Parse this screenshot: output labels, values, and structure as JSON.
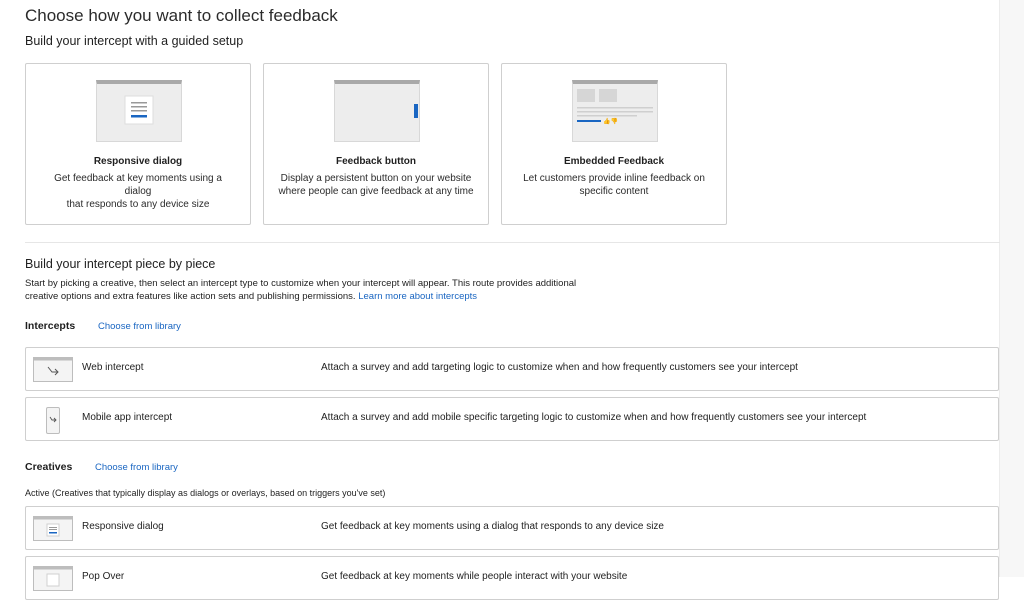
{
  "page": {
    "title": "Choose how you want to collect feedback",
    "guided_heading": "Build your intercept with a guided setup"
  },
  "cards": [
    {
      "title": "Responsive dialog",
      "desc_line1": "Get feedback at key moments using a dialog",
      "desc_line2": "that responds to any device size",
      "icon": "responsive-dialog-thumbnail"
    },
    {
      "title": "Feedback button",
      "desc_line1": "Display a persistent button on your website",
      "desc_line2": "where people can give feedback at any time",
      "icon": "feedback-button-thumbnail"
    },
    {
      "title": "Embedded Feedback",
      "desc_line1": "Let customers provide inline feedback on",
      "desc_line2": "specific content",
      "icon": "embedded-feedback-thumbnail"
    }
  ],
  "piece": {
    "heading": "Build your intercept piece by piece",
    "desc_line1": "Start by picking a creative, then select an intercept type to customize when your intercept will appear. This route provides additional",
    "desc_line2": "creative options and extra features like action sets and publishing permissions.",
    "learn_more": "Learn more about intercepts"
  },
  "intercepts": {
    "label": "Intercepts",
    "library_link": "Choose from library",
    "items": [
      {
        "name": "Web intercept",
        "desc": "Attach a survey and add targeting logic to customize when and how frequently customers see your intercept",
        "icon": "web-intercept-icon"
      },
      {
        "name": "Mobile app intercept",
        "desc": "Attach a survey and add mobile specific targeting logic to customize when and how frequently customers see your intercept",
        "icon": "mobile-intercept-icon"
      }
    ]
  },
  "creatives": {
    "label": "Creatives",
    "library_link": "Choose from library",
    "active_note": "Active (Creatives that typically display as dialogs or overlays, based on triggers you've set)",
    "items": [
      {
        "name": "Responsive dialog",
        "desc": "Get feedback at key moments using a dialog that responds to any device size",
        "icon": "responsive-dialog-icon"
      },
      {
        "name": "Pop Over",
        "desc": "Get feedback at key moments while people interact with your website",
        "icon": "pop-over-icon"
      }
    ]
  },
  "colors": {
    "accent": "#1a66c2",
    "border": "#cfcfcf",
    "text": "#1f1f1f"
  }
}
